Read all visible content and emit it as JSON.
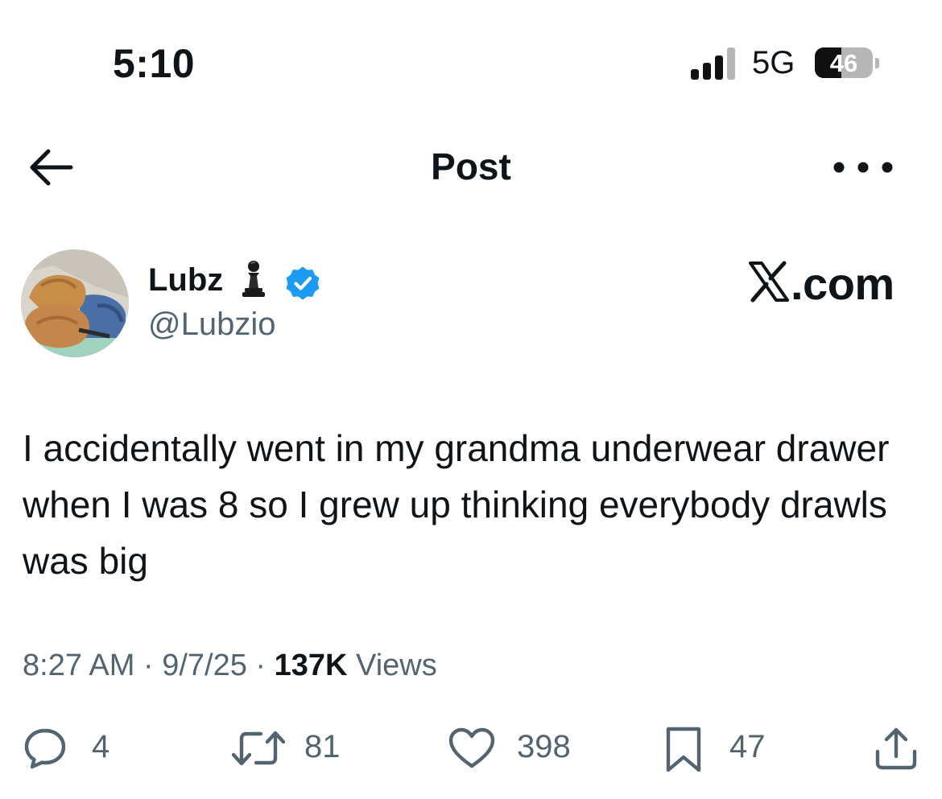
{
  "status_bar": {
    "time": "5:10",
    "network": "5G",
    "battery_percent": "46",
    "battery_level": 0.46,
    "signal_bars_active": 3,
    "signal_bars_total": 4
  },
  "header": {
    "title": "Post",
    "back_icon": "arrow-left-icon",
    "more_icon": "more-horizontal-icon"
  },
  "post": {
    "author": {
      "display_name": "Lubz",
      "emoji_icon": "chess-pawn-icon",
      "verified": true,
      "handle": "@Lubzio"
    },
    "watermark": {
      "logo_icon": "x-logo-icon",
      "text": ".com"
    },
    "text": "I accidentally went in my grandma underwear drawer when I was 8 so I grew up thinking everybody drawls was big",
    "meta": {
      "time": "8:27 AM",
      "date": "9/7/25",
      "views_count": "137K",
      "views_label": "Views"
    },
    "actions": {
      "replies": "4",
      "reposts": "81",
      "likes": "398",
      "bookmarks": "47"
    }
  },
  "colors": {
    "text_primary": "#0f1419",
    "text_secondary": "#536471",
    "verified_blue": "#1d9bf0"
  }
}
